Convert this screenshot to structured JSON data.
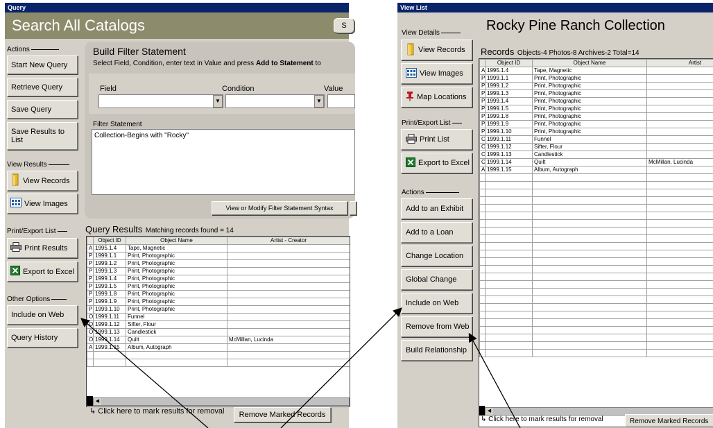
{
  "query": {
    "window_title": "Query",
    "header_title": "Search All Catalogs",
    "header_button": "S",
    "actions_label": "Actions",
    "actions": [
      "Start New Query",
      "Retrieve Query",
      "Save Query",
      "Save Results to List"
    ],
    "view_results_label": "View Results",
    "view_records": "View Records",
    "view_images": "View Images",
    "print_export_label": "Print/Export List",
    "print_results": "Print Results",
    "export_excel": "Export to Excel",
    "other_options_label": "Other Options",
    "include_on_web": "Include on Web",
    "query_history": "Query History",
    "build_filter": {
      "title": "Build Filter Statement",
      "instruction_pre": "Select Field, Condition, enter text in Value and press ",
      "instruction_bold": "Add to Statement",
      "instruction_post": " to",
      "field_label": "Field",
      "condition_label": "Condition",
      "value_label": "Value",
      "filter_statement_label": "Filter Statement",
      "filter_statement_value": "Collection-Begins with \"Rocky\"",
      "modify_button": "View or Modify Filter Statement Syntax"
    },
    "results_title": "Query Results",
    "results_count": "Matching records found = 14",
    "columns": [
      "Object ID",
      "Object Name",
      "Artist - Creator"
    ],
    "rows": [
      [
        "A",
        "1995.1.4",
        "Tape, Magnetic",
        ""
      ],
      [
        "P",
        "1999.1.1",
        "Print, Photographic",
        ""
      ],
      [
        "P",
        "1999.1.2",
        "Print, Photographic",
        ""
      ],
      [
        "P",
        "1999.1.3",
        "Print, Photographic",
        ""
      ],
      [
        "P",
        "1999.1.4",
        "Print, Photographic",
        ""
      ],
      [
        "P",
        "1999.1.5",
        "Print, Photographic",
        ""
      ],
      [
        "P",
        "1999.1.8",
        "Print, Photographic",
        ""
      ],
      [
        "P",
        "1999.1.9",
        "Print, Photographic",
        ""
      ],
      [
        "P",
        "1999.1.10",
        "Print, Photographic",
        ""
      ],
      [
        "O",
        "1999.1.11",
        "Funnel",
        ""
      ],
      [
        "O",
        "1999.1.12",
        "Sifter, Flour",
        ""
      ],
      [
        "O",
        "1999.1.13",
        "Candlestick",
        ""
      ],
      [
        "O",
        "1999.1.14",
        "Quilt",
        "McMillan, Lucinda"
      ],
      [
        "A",
        "1999.1.15",
        "Album, Autograph",
        ""
      ]
    ],
    "mark_hint": "Click here to mark results for removal",
    "remove_marked": "Remove Marked Records"
  },
  "viewlist": {
    "window_title": "View List",
    "collection_title": "Rocky Pine Ranch Collection",
    "view_details_label": "View Details",
    "view_records": "View Records",
    "view_images": "View Images",
    "map_locations": "Map Locations",
    "print_export_label": "Print/Export List",
    "print_list": "Print List",
    "export_excel": "Export to Excel",
    "actions_label": "Actions",
    "actions": [
      "Add to an Exhibit",
      "Add to a Loan",
      "Change Location",
      "Global Change",
      "Include on Web",
      "Remove from Web",
      "Build Relationship"
    ],
    "records_title": "Records",
    "records_counts": "Objects-4 Photos-8 Archives-2 Total=14",
    "columns": [
      "Object ID",
      "Object Name",
      "Artist"
    ],
    "mark_hint": "Click here to mark results for removal",
    "remove_marked": "Remove Marked Records"
  }
}
